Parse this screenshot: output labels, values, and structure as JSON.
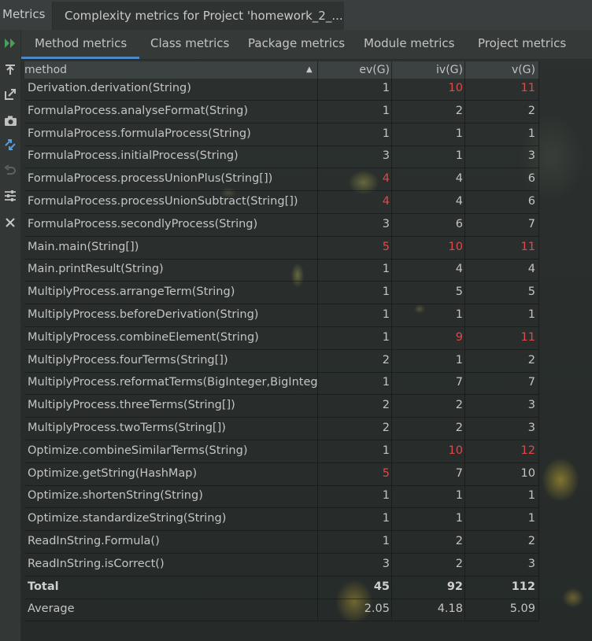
{
  "titlebar": {
    "app_label": "Metrics",
    "tab_label": "Complexity metrics for Project 'homework_2_..."
  },
  "toolbar_icons": [
    "run-icon",
    "export-icon",
    "open-external-icon",
    "camera-icon",
    "diff-icon",
    "undo-icon",
    "settings-icon",
    "close-icon"
  ],
  "tabs": [
    {
      "label": "Method metrics",
      "active": true
    },
    {
      "label": "Class metrics",
      "active": false
    },
    {
      "label": "Package metrics",
      "active": false
    },
    {
      "label": "Module metrics",
      "active": false
    },
    {
      "label": "Project metrics",
      "active": false
    }
  ],
  "columns": {
    "method": "method",
    "ev": "ev(G)",
    "iv": "iv(G)",
    "v": "v(G)"
  },
  "rows": [
    {
      "method": "Derivation.derivation(String)",
      "ev": "1",
      "iv": "10",
      "v": "11"
    },
    {
      "method": "FormulaProcess.analyseFormat(String)",
      "ev": "1",
      "iv": "2",
      "v": "2"
    },
    {
      "method": "FormulaProcess.formulaProcess(String)",
      "ev": "1",
      "iv": "1",
      "v": "1"
    },
    {
      "method": "FormulaProcess.initialProcess(String)",
      "ev": "3",
      "iv": "1",
      "v": "3"
    },
    {
      "method": "FormulaProcess.processUnionPlus(String[])",
      "ev": "4",
      "iv": "4",
      "v": "6"
    },
    {
      "method": "FormulaProcess.processUnionSubtract(String[])",
      "ev": "4",
      "iv": "4",
      "v": "6"
    },
    {
      "method": "FormulaProcess.secondlyProcess(String)",
      "ev": "3",
      "iv": "6",
      "v": "7"
    },
    {
      "method": "Main.main(String[])",
      "ev": "5",
      "iv": "10",
      "v": "11"
    },
    {
      "method": "Main.printResult(String)",
      "ev": "1",
      "iv": "4",
      "v": "4"
    },
    {
      "method": "MultiplyProcess.arrangeTerm(String)",
      "ev": "1",
      "iv": "5",
      "v": "5"
    },
    {
      "method": "MultiplyProcess.beforeDerivation(String)",
      "ev": "1",
      "iv": "1",
      "v": "1"
    },
    {
      "method": "MultiplyProcess.combineElement(String)",
      "ev": "1",
      "iv": "9",
      "v": "11"
    },
    {
      "method": "MultiplyProcess.fourTerms(String[])",
      "ev": "2",
      "iv": "1",
      "v": "2"
    },
    {
      "method": "MultiplyProcess.reformatTerms(BigInteger,BigInteg",
      "ev": "1",
      "iv": "7",
      "v": "7"
    },
    {
      "method": "MultiplyProcess.threeTerms(String[])",
      "ev": "2",
      "iv": "2",
      "v": "3"
    },
    {
      "method": "MultiplyProcess.twoTerms(String[])",
      "ev": "2",
      "iv": "2",
      "v": "3"
    },
    {
      "method": "Optimize.combineSimilarTerms(String)",
      "ev": "1",
      "iv": "10",
      "v": "12"
    },
    {
      "method": "Optimize.getString(HashMap)",
      "ev": "5",
      "iv": "7",
      "v": "10"
    },
    {
      "method": "Optimize.shortenString(String)",
      "ev": "1",
      "iv": "1",
      "v": "1"
    },
    {
      "method": "Optimize.standardizeString(String)",
      "ev": "1",
      "iv": "1",
      "v": "1"
    },
    {
      "method": "ReadInString.Formula()",
      "ev": "1",
      "iv": "2",
      "v": "2"
    },
    {
      "method": "ReadInString.isCorrect()",
      "ev": "3",
      "iv": "2",
      "v": "3"
    }
  ],
  "total": {
    "method": "Total",
    "ev": "45",
    "iv": "92",
    "v": "112"
  },
  "average": {
    "method": "Average",
    "ev": "2.05",
    "iv": "4.18",
    "v": "5.09"
  },
  "colors": {
    "highlight_red": "#e0494b",
    "active_tab_underline": "#4a88c7"
  }
}
